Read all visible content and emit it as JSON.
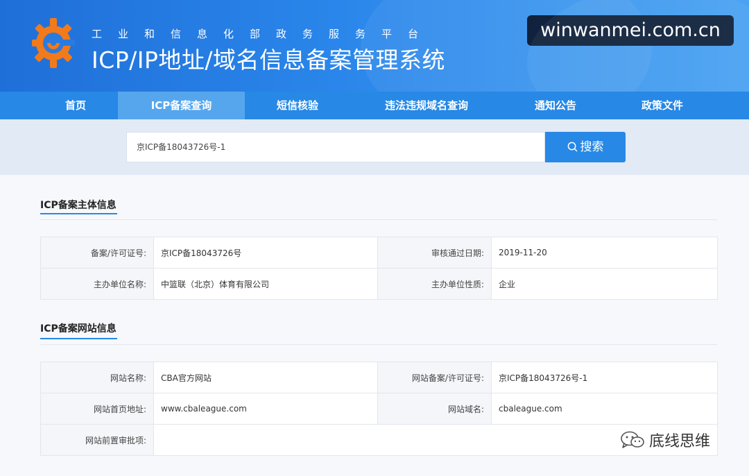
{
  "header": {
    "subtitle": "工业和信息化部政务服务平台",
    "title": "ICP/IP地址/域名信息备案管理系统",
    "watermark": "winwanmei.com.cn"
  },
  "nav": {
    "items": [
      "首页",
      "ICP备案查询",
      "短信核验",
      "违法违规域名查询",
      "通知公告",
      "政策文件"
    ],
    "active_index": 1
  },
  "search": {
    "value": "京ICP备18043726号-1",
    "button_label": "搜索"
  },
  "sections": {
    "subject": {
      "title": "ICP备案主体信息",
      "license_label": "备案/许可证号:",
      "license_value": "京ICP备18043726号",
      "approve_date_label": "审核通过日期:",
      "approve_date_value": "2019-11-20",
      "org_name_label": "主办单位名称:",
      "org_name_value": "中篮联（北京）体育有限公司",
      "org_type_label": "主办单位性质:",
      "org_type_value": "企业"
    },
    "website": {
      "title": "ICP备案网站信息",
      "site_name_label": "网站名称:",
      "site_name_value": "CBA官方网站",
      "site_license_label": "网站备案/许可证号:",
      "site_license_value": "京ICP备18043726号-1",
      "homepage_label": "网站首页地址:",
      "homepage_value": "www.cbaleague.com",
      "domain_label": "网站域名:",
      "domain_value": "cbaleague.com",
      "preapproval_label": "网站前置审批项:",
      "preapproval_value": ""
    }
  },
  "wechat_watermark": "底线思维",
  "colors": {
    "primary": "#2788e6",
    "nav_active": "#56a6ee",
    "logo_orange": "#f27a1a"
  }
}
